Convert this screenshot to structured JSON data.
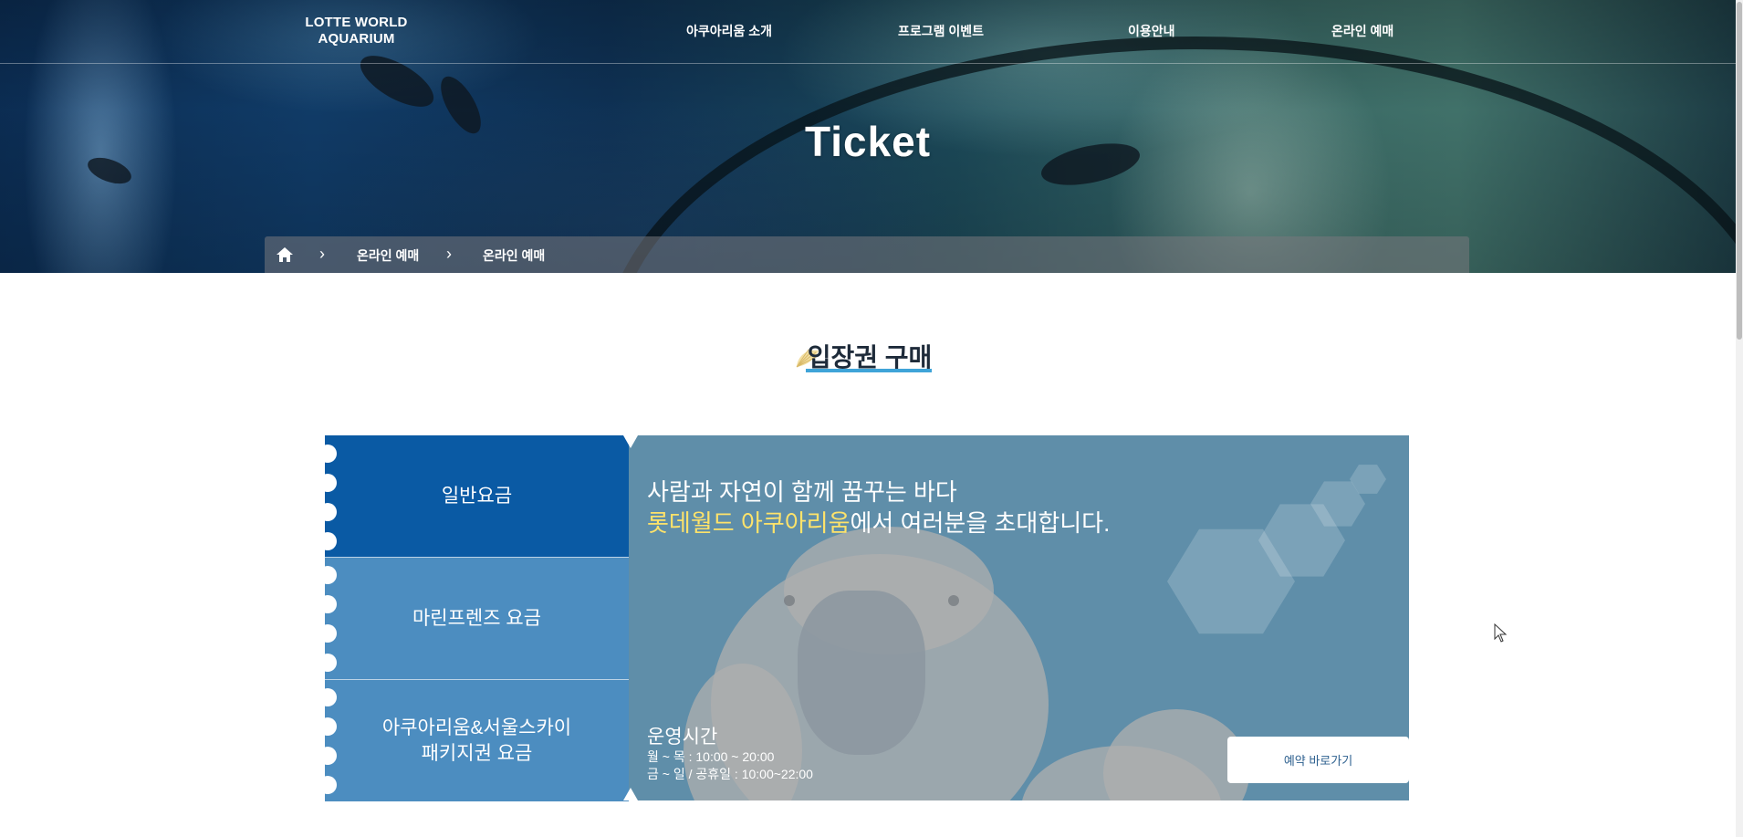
{
  "header": {
    "logo_line1": "LOTTE WORLD",
    "logo_line2": "AQUARIUM",
    "nav": [
      "아쿠아리움 소개",
      "프로그램 이벤트",
      "이용안내",
      "온라인 예매"
    ]
  },
  "hero": {
    "title": "Ticket"
  },
  "breadcrumb": {
    "home_icon": "home-icon",
    "items": [
      "온라인 예매",
      "온라인 예매"
    ]
  },
  "section": {
    "title": "입장권 구매",
    "icon": "shell-icon"
  },
  "ticket": {
    "tabs": [
      {
        "line1": "일반요금",
        "line2": "",
        "active": true
      },
      {
        "line1": "마린프렌즈 요금",
        "line2": "",
        "active": false
      },
      {
        "line1": "아쿠아리움&서울스카이",
        "line2": "패키지권 요금",
        "active": false
      }
    ],
    "headline1": "사람과 자연이 함께 꿈꾸는 바다",
    "headline2_highlight": "롯데월드 아쿠아리움",
    "headline2_rest": "에서 여러분을 초대합니다.",
    "hours_title": "운영시간",
    "hours_weekday": "월 ~ 목 : 10:00 ~ 20:00",
    "hours_weekend": "금 ~ 일 / 공휴일 : 10:00~22:00",
    "reserve_button": "예약 바로가기"
  },
  "colors": {
    "tab_active": "#0a5aa4",
    "tab_inactive": "#4c8dc0",
    "panel_bg": "#5f8ea9",
    "highlight": "#ffe36a",
    "title_underline": "#3fa4d8"
  }
}
